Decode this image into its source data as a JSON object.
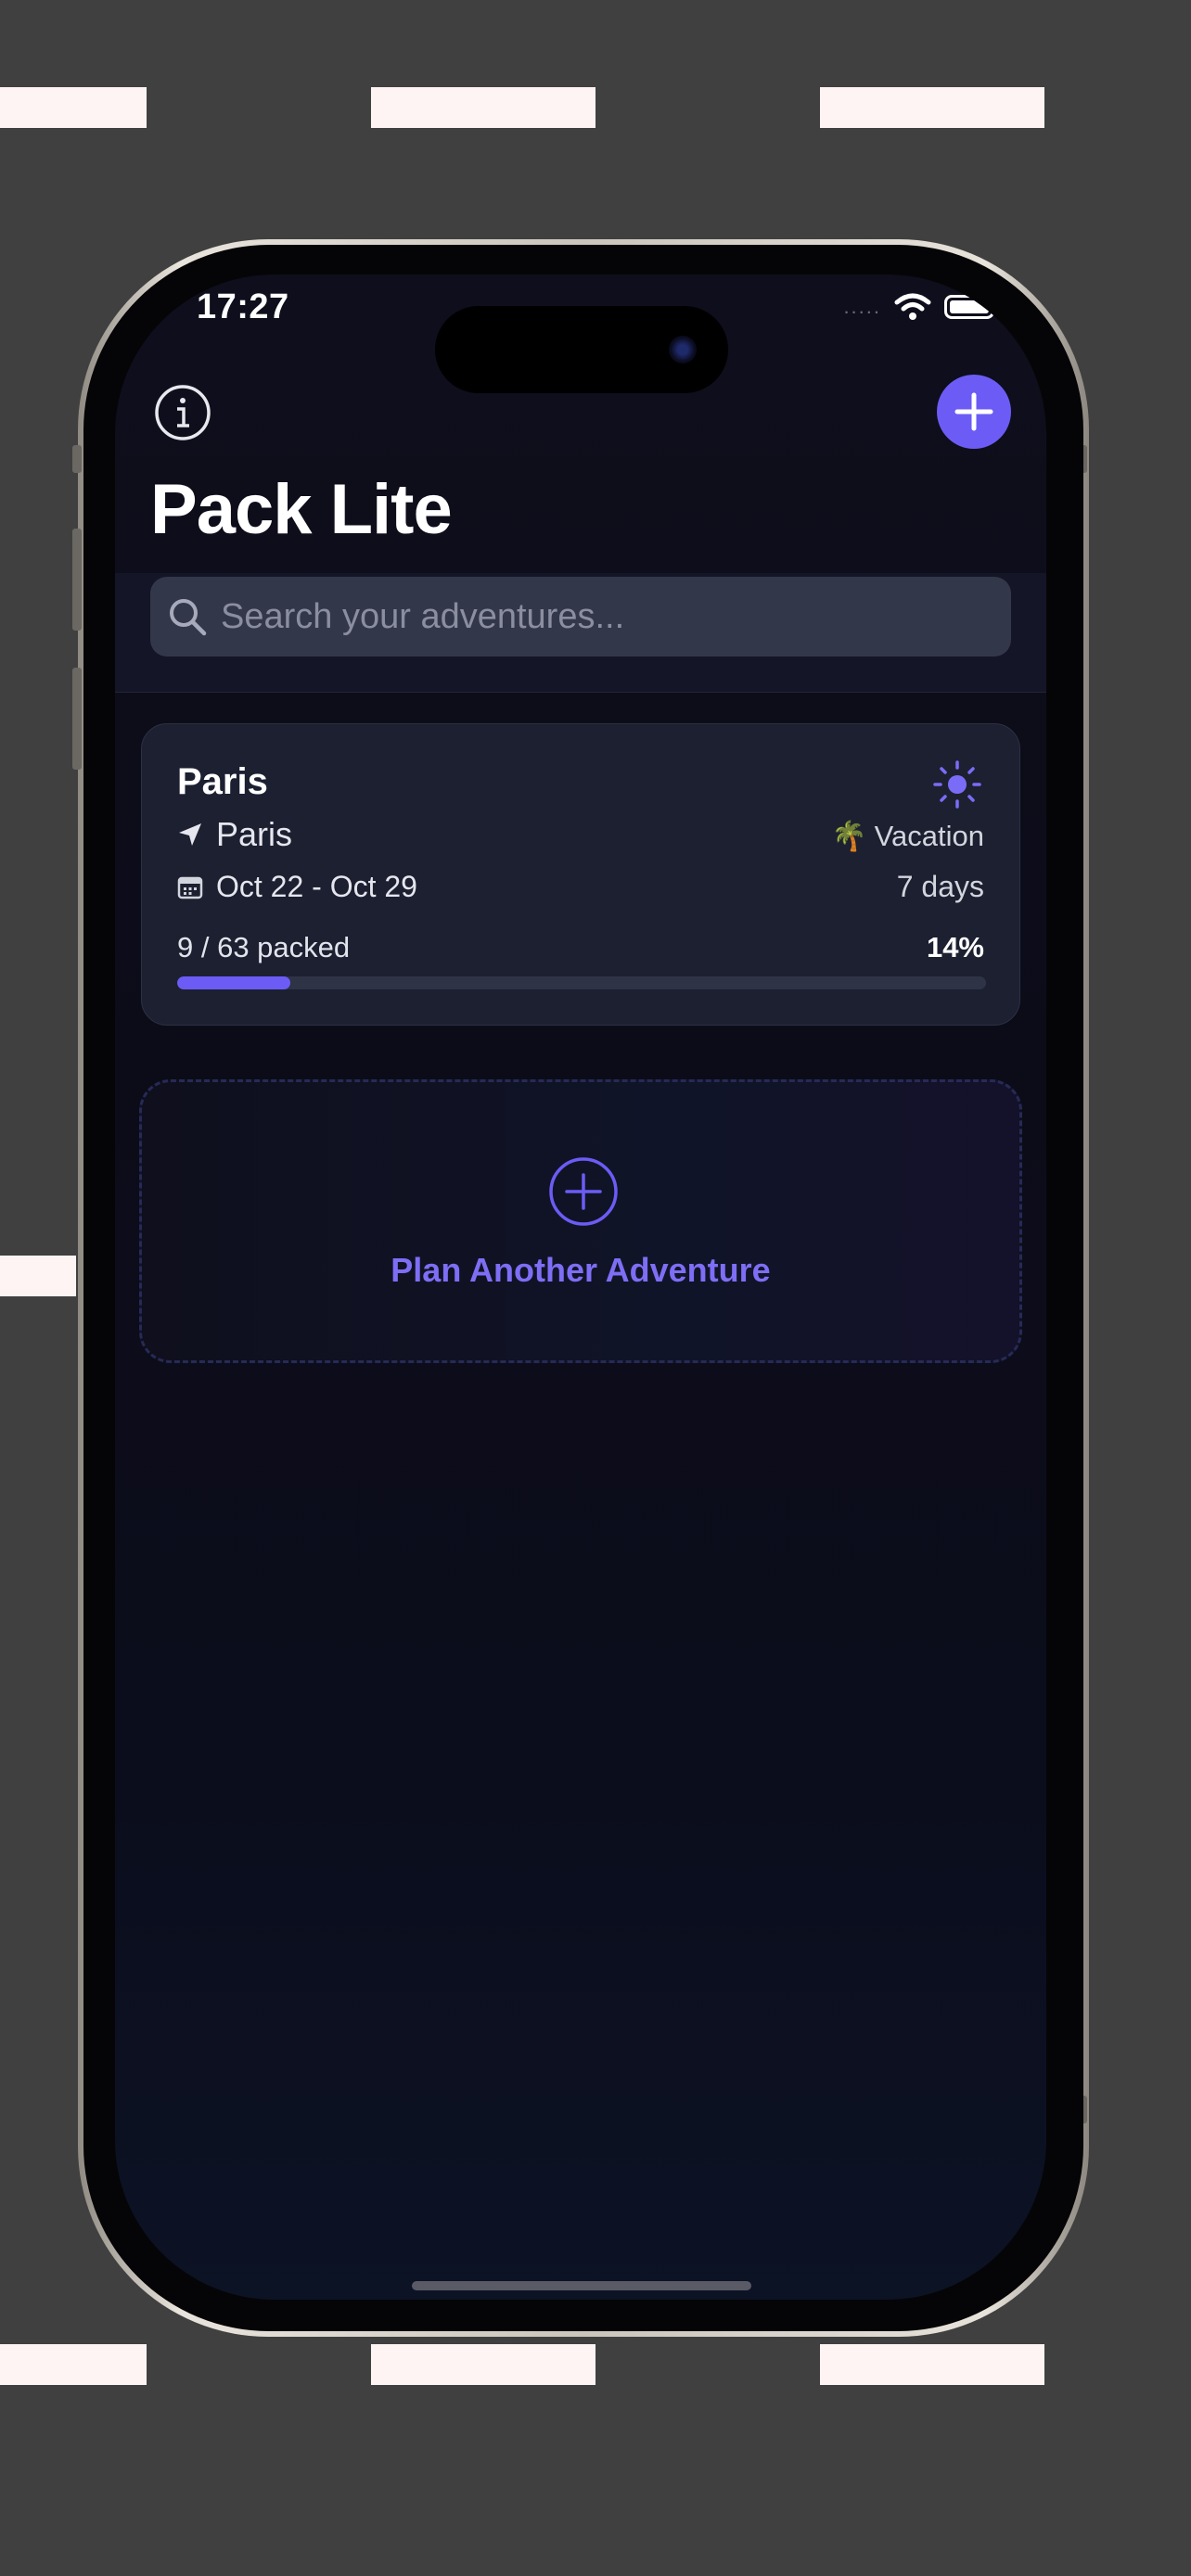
{
  "status_bar": {
    "time": "17:27",
    "signal": "....."
  },
  "header": {
    "title": "Pack Lite",
    "info_icon": "info-circle-icon",
    "add_icon": "plus-icon"
  },
  "search": {
    "placeholder": "Search your adventures...",
    "value": ""
  },
  "trips": [
    {
      "name": "Paris",
      "location": "Paris",
      "type": "Vacation",
      "type_emoji": "🌴",
      "dates": "Oct 22 - Oct 29",
      "duration": "7 days",
      "packed_text": "9 / 63 packed",
      "packed_percent_text": "14%",
      "packed_fraction": 0.14,
      "weather_icon": "sun-icon"
    }
  ],
  "plan_card": {
    "label": "Plan Another Adventure",
    "icon": "plus-circle-icon"
  },
  "colors": {
    "accent": "#6c5cf5",
    "background": "#0e0e1c",
    "card": "#1c2031",
    "search_field": "#33374a",
    "outer_background": "#404040"
  }
}
